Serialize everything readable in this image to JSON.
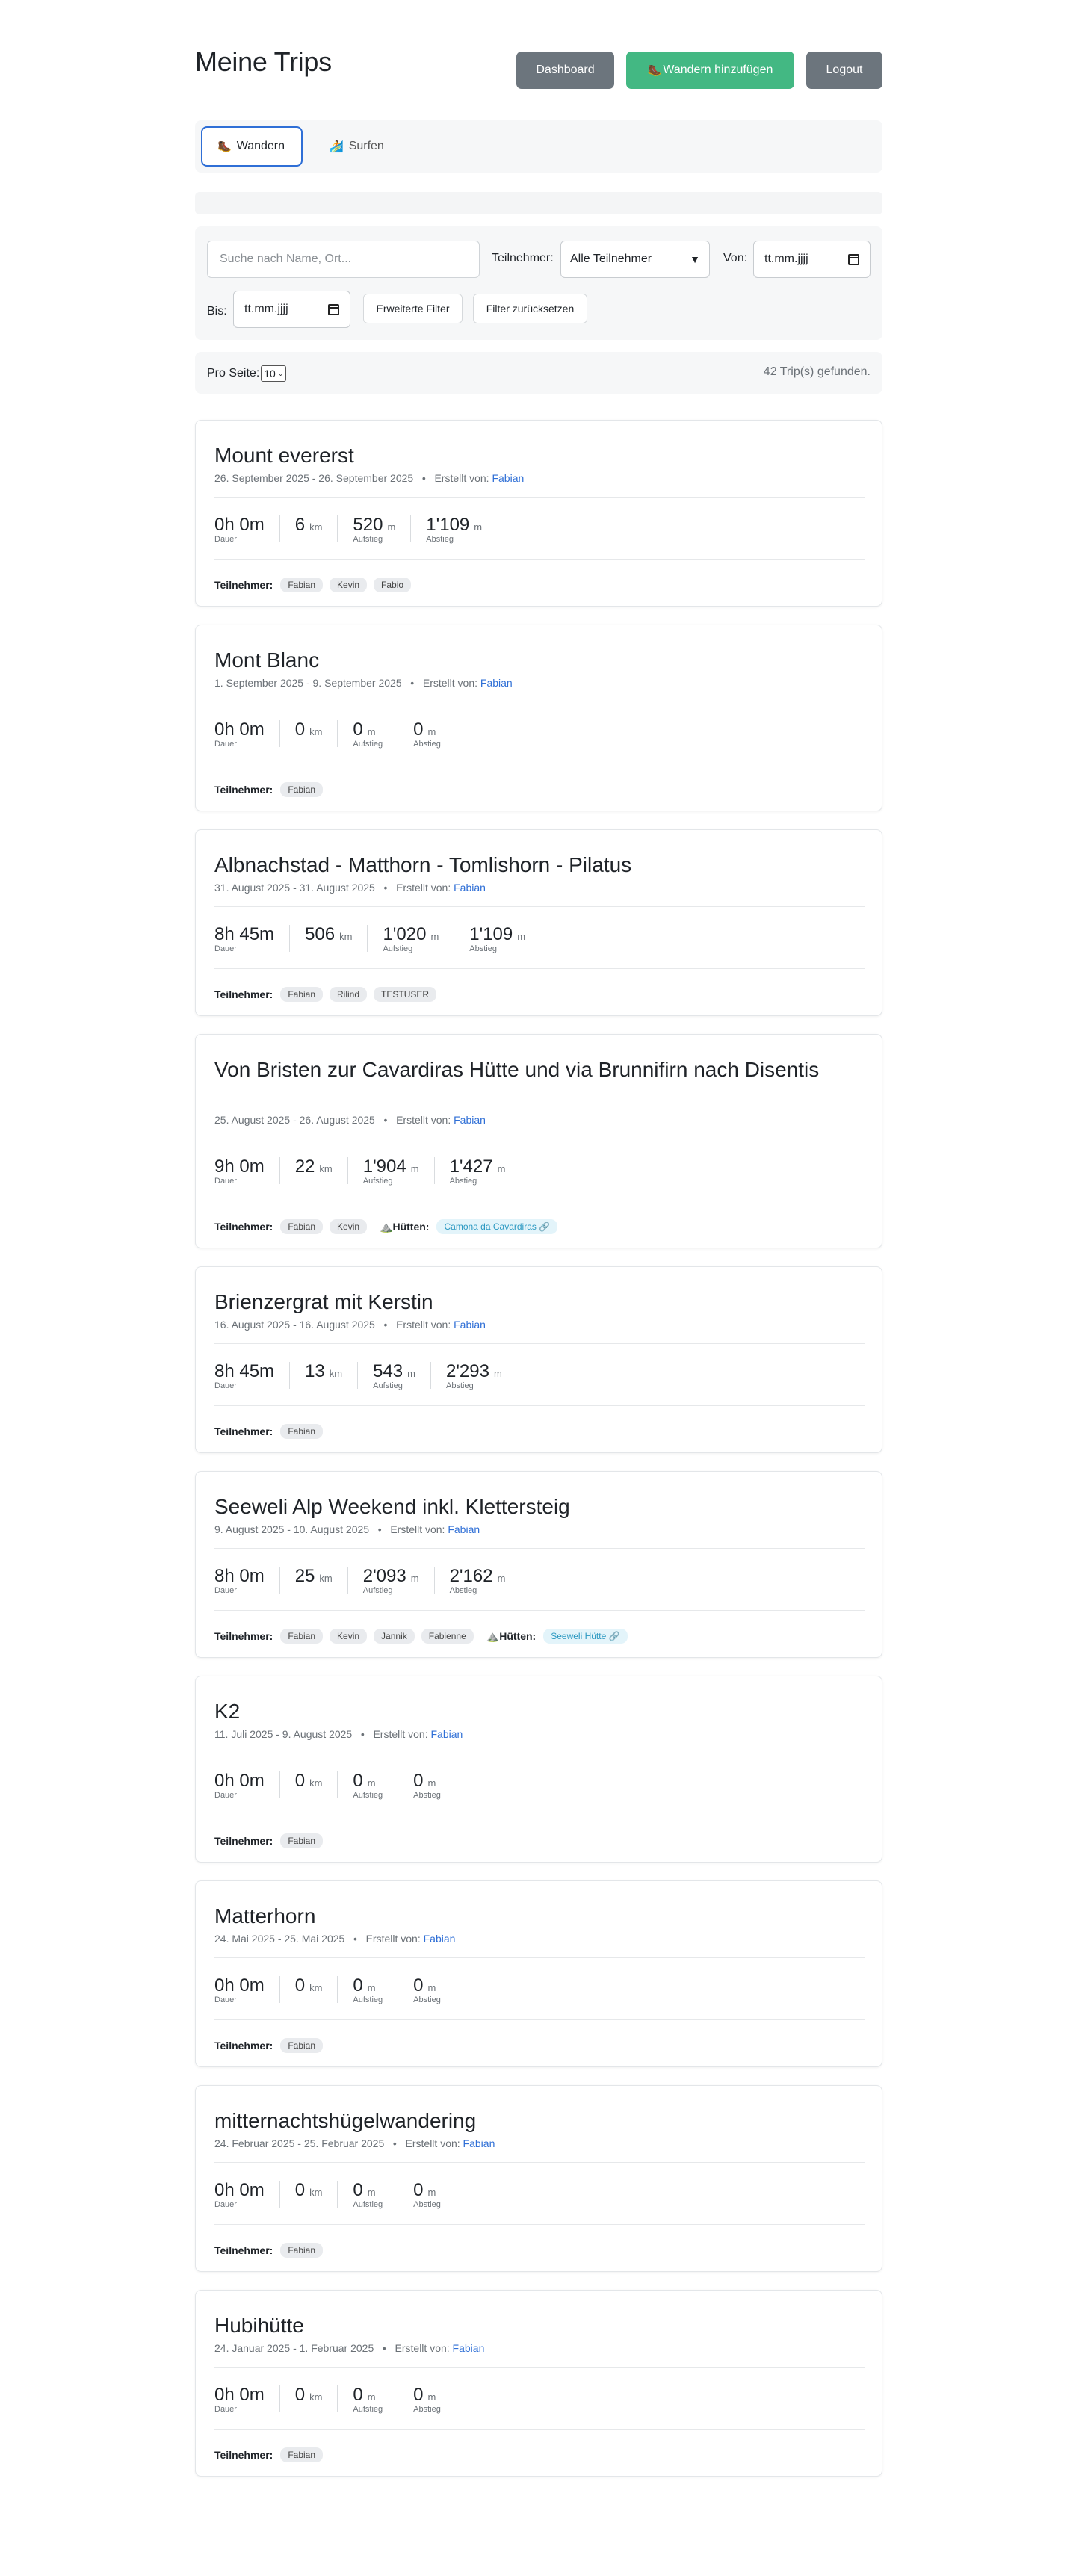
{
  "header": {
    "title": "Meine Trips",
    "dashboard_label": "Dashboard",
    "add_label": "Wandern hinzufügen",
    "logout_label": "Logout",
    "colors": {
      "primary_gray": "#6c757d",
      "add_green": "#43b883",
      "link_blue": "#2f6fd6"
    }
  },
  "tabs": [
    {
      "label": "Wandern",
      "icon": "hiking-boot-icon",
      "active": true
    },
    {
      "label": "Surfen",
      "icon": "surfer-icon",
      "active": false
    }
  ],
  "filters": {
    "search_placeholder": "Suche nach Name, Ort...",
    "participants_label": "Teilnehmer:",
    "participants_value": "Alle Teilnehmer",
    "from_label": "Von:",
    "from_value": "tt.mm.jjjj",
    "to_label": "Bis:",
    "to_value": "tt.mm.jjjj",
    "advanced_label": "Erweiterte Filter",
    "reset_label": "Filter zurücksetzen"
  },
  "pager": {
    "per_page_label": "Pro Seite:",
    "per_page_value": "10",
    "found_text": "42 Trip(s) gefunden."
  },
  "labels": {
    "created_by": "Erstellt von:",
    "duration": "Dauer",
    "ascent": "Aufstieg",
    "descent": "Abstieg",
    "unit_km": "km",
    "unit_m": "m",
    "participants": "Teilnehmer:",
    "huts": "Hütten:"
  },
  "trips": [
    {
      "title": "Mount evererst",
      "dates": "26. September 2025 - 26. September 2025",
      "author": "Fabian",
      "duration": "0h 0m",
      "distance": "6",
      "ascent": "520",
      "descent": "1'109",
      "participants": [
        "Fabian",
        "Kevin",
        "Fabio"
      ],
      "huts": []
    },
    {
      "title": "Mont Blanc",
      "dates": "1. September 2025 - 9. September 2025",
      "author": "Fabian",
      "duration": "0h 0m",
      "distance": "0",
      "ascent": "0",
      "descent": "0",
      "participants": [
        "Fabian"
      ],
      "huts": []
    },
    {
      "title": "Albnachstad - Matthorn - Tomlishorn - Pilatus",
      "dates": "31. August 2025 - 31. August 2025",
      "author": "Fabian",
      "duration": "8h 45m",
      "distance": "506",
      "ascent": "1'020",
      "descent": "1'109",
      "participants": [
        "Fabian",
        "Rilind",
        "TESTUSER"
      ],
      "huts": []
    },
    {
      "title": "Von Bristen zur Cavardiras Hütte und via Brunnifirn nach Disentis",
      "dates": "25. August 2025 - 26. August 2025",
      "author": "Fabian",
      "duration": "9h 0m",
      "distance": "22",
      "ascent": "1'904",
      "descent": "1'427",
      "participants": [
        "Fabian",
        "Kevin"
      ],
      "huts": [
        "Camona da Cavardiras 🔗"
      ]
    },
    {
      "title": "Brienzergrat mit Kerstin",
      "dates": "16. August 2025 - 16. August 2025",
      "author": "Fabian",
      "duration": "8h 45m",
      "distance": "13",
      "ascent": "543",
      "descent": "2'293",
      "participants": [
        "Fabian"
      ],
      "huts": []
    },
    {
      "title": "Seeweli Alp Weekend inkl. Klettersteig",
      "dates": "9. August 2025 - 10. August 2025",
      "author": "Fabian",
      "duration": "8h 0m",
      "distance": "25",
      "ascent": "2'093",
      "descent": "2'162",
      "participants": [
        "Fabian",
        "Kevin",
        "Jannik",
        "Fabienne"
      ],
      "huts": [
        "Seeweli Hütte 🔗"
      ]
    },
    {
      "title": "K2",
      "dates": "11. Juli 2025 - 9. August 2025",
      "author": "Fabian",
      "duration": "0h 0m",
      "distance": "0",
      "ascent": "0",
      "descent": "0",
      "participants": [
        "Fabian"
      ],
      "huts": []
    },
    {
      "title": "Matterhorn",
      "dates": "24. Mai 2025 - 25. Mai 2025",
      "author": "Fabian",
      "duration": "0h 0m",
      "distance": "0",
      "ascent": "0",
      "descent": "0",
      "participants": [
        "Fabian"
      ],
      "huts": []
    },
    {
      "title": "mitternachtshügelwandering",
      "dates": "24. Februar 2025 - 25. Februar 2025",
      "author": "Fabian",
      "duration": "0h 0m",
      "distance": "0",
      "ascent": "0",
      "descent": "0",
      "participants": [
        "Fabian"
      ],
      "huts": []
    },
    {
      "title": "Hubihütte",
      "dates": "24. Januar 2025 - 1. Februar 2025",
      "author": "Fabian",
      "duration": "0h 0m",
      "distance": "0",
      "ascent": "0",
      "descent": "0",
      "participants": [
        "Fabian"
      ],
      "huts": []
    }
  ]
}
